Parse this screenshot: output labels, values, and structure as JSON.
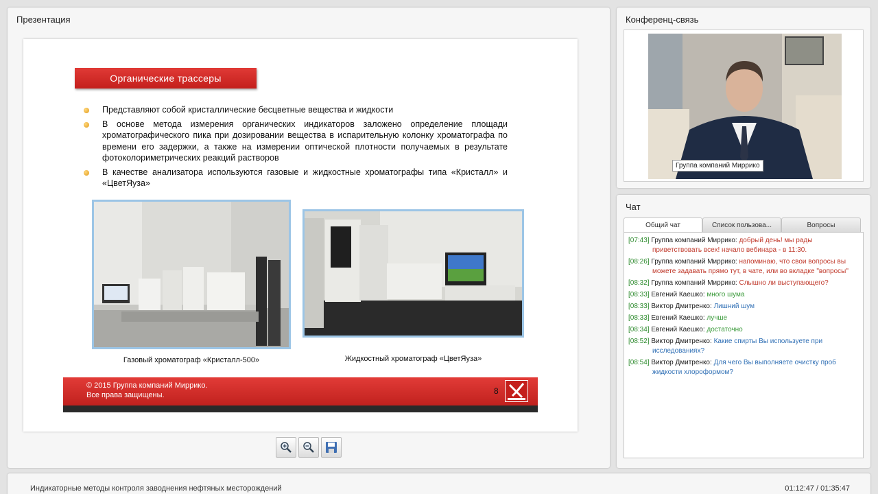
{
  "presentation": {
    "panel_title": "Презентация",
    "slide": {
      "heading": "Органические трассеры",
      "bullets": [
        "Представляют собой кристаллические бесцветные вещества  и жидкости",
        "В основе метода измерения органических индикаторов заложено определение площади хроматографического пика при дозировании вещества в испарительную колонку хроматографа по времени его задержки, а также на измерении оптической плотности получаемых в результате фотоколориметрических реакций  растворов",
        "В качестве анализатора используются газовые и жидкостные хроматографы типа «Кристалл» и «ЦветЯуза»"
      ],
      "caption1": "Газовый хроматограф  «Кристалл-500»",
      "caption2": "Жидкостный  хроматограф  «ЦветЯуза»",
      "footer_line1": "© 2015 Группа компаний Миррико.",
      "footer_line2": "Все права защищены.",
      "page_number": "8"
    },
    "toolbar": [
      "zoom-in-icon",
      "zoom-out-icon",
      "save-icon"
    ]
  },
  "conference": {
    "panel_title": "Конференц-связь",
    "video_label": "Группа компаний Миррико"
  },
  "chat": {
    "panel_title": "Чат",
    "tabs": [
      "Общий чат",
      "Список пользова...",
      "Вопросы"
    ],
    "messages": [
      {
        "time": "[07:43]",
        "author": "Группа компаний Миррико:",
        "text": "добрый день! мы рады приветствовать всех! начало вебинара - в 11:30."
      },
      {
        "time": "[08:26]",
        "author": "Группа компаний Миррико:",
        "text": "напоминаю, что свои вопросы вы можете задавать прямо тут, в чате, или во вкладке \"вопросы\""
      },
      {
        "time": "[08:32]",
        "author": "Группа компаний Миррико:",
        "text": "Слышно ли выступающего?"
      },
      {
        "time": "[08:33]",
        "author": "Евгений Каешко:",
        "text": "много шума"
      },
      {
        "time": "[08:33]",
        "author": "Виктор Дмитренко:",
        "text": "Лишний шум"
      },
      {
        "time": "[08:33]",
        "author": "Евгений Каешко:",
        "text": "лучше"
      },
      {
        "time": "[08:34]",
        "author": "Евгений Каешко:",
        "text": "достаточно"
      },
      {
        "time": "[08:52]",
        "author": "Виктор Дмитренко:",
        "text": "Какие спирты Вы используете при исследованиях?"
      },
      {
        "time": "[08:54]",
        "author": "Виктор Дмитренко:",
        "text": "Для чего Вы выполняете очистку проб жидкости хлороформом?"
      }
    ],
    "colors": {
      "organizer": "#c0392b",
      "kaeshko": "#3a9a3a",
      "dmitrenko": "#2f6fb5",
      "time": "#2e8b2e"
    }
  },
  "bottom": {
    "title": "Индикаторные методы контроля заводнения нефтяных месторождений",
    "time": "01:12:47 / 01:35:47"
  }
}
